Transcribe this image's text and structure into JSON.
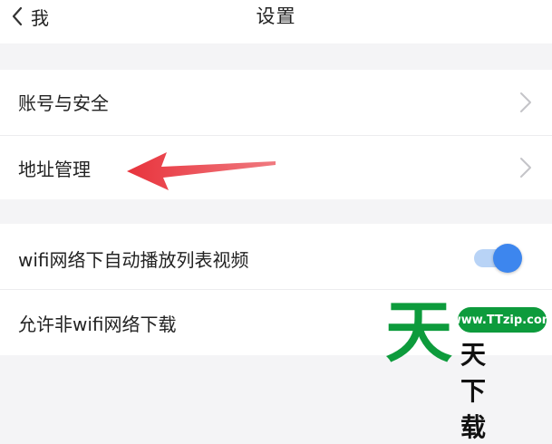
{
  "header": {
    "back_label": "我",
    "title": "设置"
  },
  "settings": {
    "account_security": "账号与安全",
    "address_management": "地址管理",
    "wifi_autoplay": "wifi网络下自动播放列表视频",
    "wifi_autoplay_enabled": true,
    "allow_non_wifi_download": "允许非wifi网络下载"
  },
  "watermark": {
    "big_char": "天",
    "url": "www.TTzip.com",
    "site_name": "天下载"
  },
  "colors": {
    "toggle_on": "#3d86ee",
    "arrow": "#e8333c",
    "watermark_green": "#0d9b3c"
  }
}
